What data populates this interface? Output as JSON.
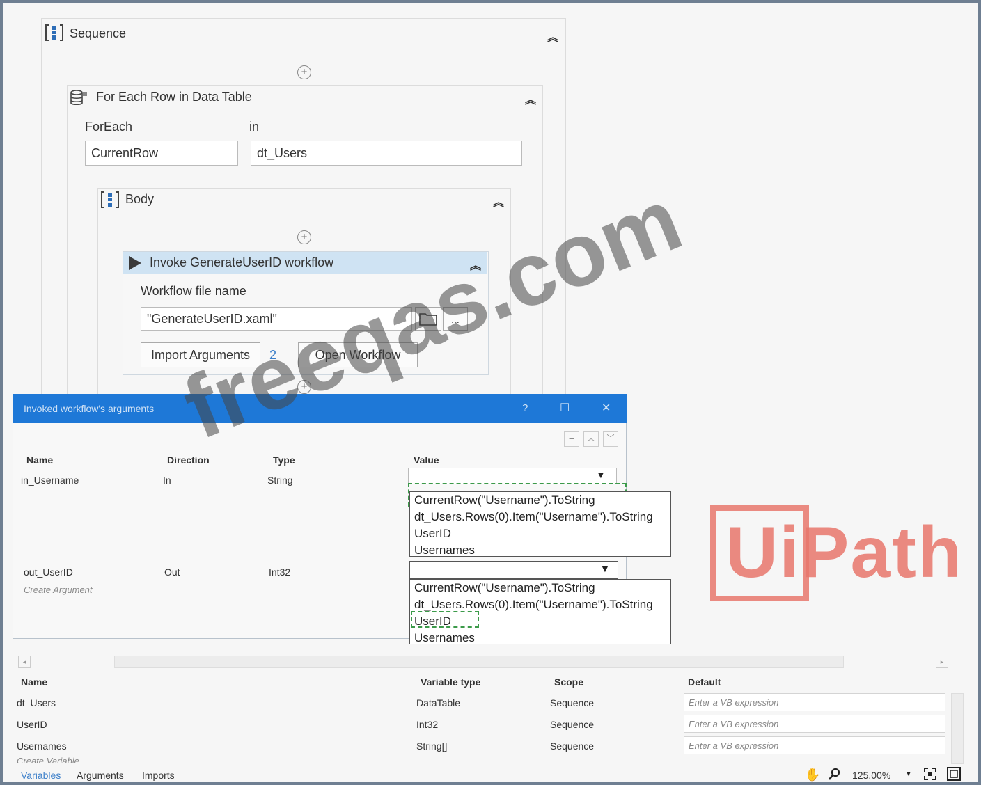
{
  "sequence": {
    "title": "Sequence"
  },
  "foreach": {
    "title": "For Each Row in Data Table",
    "foreach_label": "ForEach",
    "in_label": "in",
    "item_value": "CurrentRow",
    "collection_value": "dt_Users"
  },
  "body": {
    "title": "Body"
  },
  "invoke": {
    "title": "Invoke GenerateUserID workflow",
    "file_label": "Workflow file name",
    "file_value": "\"GenerateUserID.xaml\"",
    "ellipsis": "...",
    "import_label": "Import Arguments",
    "import_count": "2",
    "open_label": "Open Workflow"
  },
  "dialog": {
    "title": "Invoked workflow's arguments",
    "help": "?",
    "maximize": "☐",
    "close": "✕",
    "columns": {
      "name": "Name",
      "direction": "Direction",
      "type": "Type",
      "value": "Value"
    },
    "rows": [
      {
        "name": "in_Username",
        "direction": "In",
        "type": "String"
      },
      {
        "name": "out_UserID",
        "direction": "Out",
        "type": "Int32"
      }
    ],
    "create_argument": "Create Argument",
    "dropdown_options": [
      "CurrentRow(\"Username\").ToString",
      "dt_Users.Rows(0).Item(\"Username\").ToString",
      "UserID",
      "Usernames"
    ]
  },
  "variables": {
    "columns": {
      "name": "Name",
      "type": "Variable type",
      "scope": "Scope",
      "default": "Default"
    },
    "rows": [
      {
        "name": "dt_Users",
        "type": "DataTable",
        "scope": "Sequence",
        "default_placeholder": "Enter a VB expression"
      },
      {
        "name": "UserID",
        "type": "Int32",
        "scope": "Sequence",
        "default_placeholder": "Enter a VB expression"
      },
      {
        "name": "Usernames",
        "type": "String[]",
        "scope": "Sequence",
        "default_placeholder": "Enter a VB expression"
      }
    ],
    "create_variable": "Create Variable"
  },
  "bottom_bar": {
    "tabs": [
      "Variables",
      "Arguments",
      "Imports"
    ],
    "zoom": "125.00%"
  },
  "watermark": {
    "text": "freeqas.com"
  },
  "logo": {
    "text": "UiPath"
  },
  "colors": {
    "dialog_header": "#1e78d7",
    "invoke_header": "#cfe3f3",
    "logo": "#e8776c",
    "link": "#3c7fc9"
  }
}
